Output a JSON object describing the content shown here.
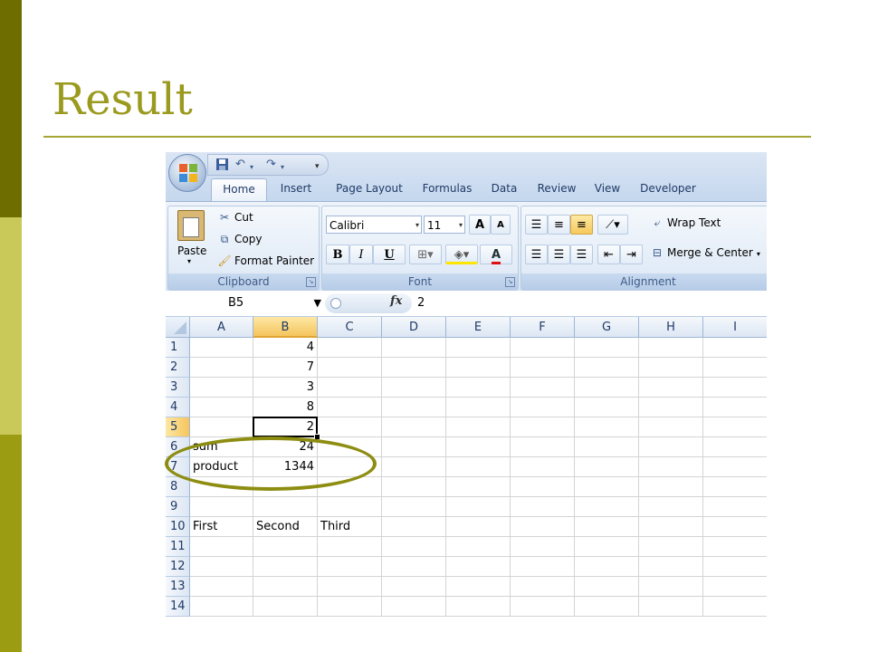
{
  "slide": {
    "title": "Result"
  },
  "excel": {
    "quick_access": {
      "save_icon": "save-icon",
      "undo_icon": "undo-icon",
      "redo_icon": "redo-icon",
      "customize_icon": "customize-qat-icon"
    },
    "tabs": [
      "Home",
      "Insert",
      "Page Layout",
      "Formulas",
      "Data",
      "Review",
      "View",
      "Developer"
    ],
    "active_tab": "Home",
    "clipboard": {
      "paste_label": "Paste",
      "cut_label": "Cut",
      "copy_label": "Copy",
      "format_painter_label": "Format Painter",
      "group_label": "Clipboard"
    },
    "font": {
      "font_name": "Calibri",
      "font_size": "11",
      "grow_label": "A",
      "shrink_label": "A",
      "bold_label": "B",
      "italic_label": "I",
      "underline_label": "U",
      "font_color_label": "A",
      "group_label": "Font"
    },
    "alignment": {
      "wrap_text_label": "Wrap Text",
      "merge_center_label": "Merge & Center",
      "group_label": "Alignment"
    },
    "formula_bar": {
      "name_box": "B5",
      "fx_label": "fx",
      "value": "2"
    },
    "columns": [
      "A",
      "B",
      "C",
      "D",
      "E",
      "F",
      "G",
      "H",
      "I"
    ],
    "selected_column": "B",
    "selected_row": "5",
    "rows": [
      {
        "num": "1",
        "A": "",
        "B": "4",
        "C": ""
      },
      {
        "num": "2",
        "A": "",
        "B": "7",
        "C": ""
      },
      {
        "num": "3",
        "A": "",
        "B": "3",
        "C": ""
      },
      {
        "num": "4",
        "A": "",
        "B": "8",
        "C": ""
      },
      {
        "num": "5",
        "A": "",
        "B": "2",
        "C": ""
      },
      {
        "num": "6",
        "A": "sum",
        "B": "24",
        "C": ""
      },
      {
        "num": "7",
        "A": "product",
        "B": "1344",
        "C": ""
      },
      {
        "num": "8",
        "A": "",
        "B": "",
        "C": ""
      },
      {
        "num": "9",
        "A": "",
        "B": "",
        "C": ""
      },
      {
        "num": "10",
        "A": "First",
        "B": "Second",
        "C": "Third"
      },
      {
        "num": "11",
        "A": "",
        "B": "",
        "C": ""
      },
      {
        "num": "12",
        "A": "",
        "B": "",
        "C": ""
      },
      {
        "num": "13",
        "A": "",
        "B": "",
        "C": ""
      },
      {
        "num": "14",
        "A": "",
        "B": "",
        "C": ""
      }
    ]
  },
  "colors": {
    "accent": "#9a9a1e",
    "ellipse": "#8d8d12"
  }
}
